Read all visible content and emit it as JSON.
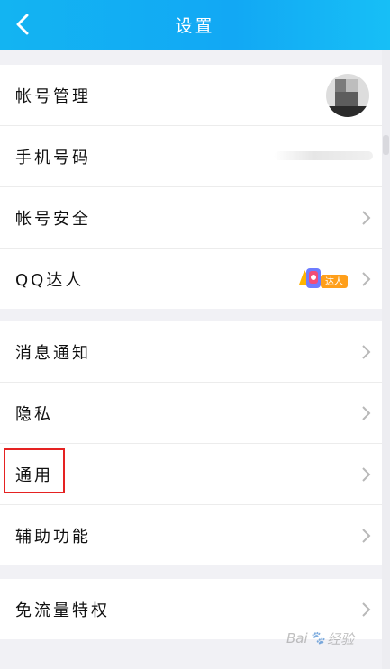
{
  "header": {
    "title": "设置",
    "back_icon": "chevron-left-icon",
    "background": "#13b4f2"
  },
  "groups": [
    {
      "items": [
        {
          "label": "帐号管理",
          "trailing": "avatar"
        },
        {
          "label": "手机号码",
          "trailing": "blurred-phone"
        },
        {
          "label": "帐号安全",
          "trailing": "chevron"
        },
        {
          "label": "QQ达人",
          "trailing": "badge-chevron",
          "badge_text": "达人"
        }
      ]
    },
    {
      "items": [
        {
          "label": "消息通知",
          "trailing": "chevron"
        },
        {
          "label": "隐私",
          "trailing": "chevron"
        },
        {
          "label": "通用",
          "trailing": "chevron",
          "highlighted": true
        },
        {
          "label": "辅助功能",
          "trailing": "chevron"
        }
      ]
    },
    {
      "items": [
        {
          "label": "免流量特权",
          "trailing": "chevron"
        }
      ]
    }
  ],
  "highlight_color": "#e52222",
  "watermark": {
    "brand": "Bai",
    "suffix": "经验"
  }
}
